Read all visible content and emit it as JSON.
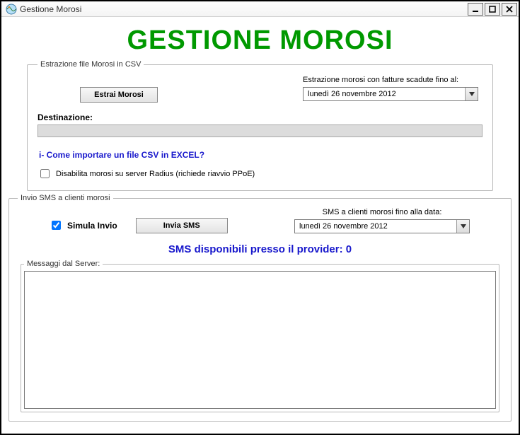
{
  "window": {
    "title": "Gestione Morosi"
  },
  "header": {
    "title": "GESTIONE MOROSI"
  },
  "extract": {
    "legend": "Estrazione file Morosi in CSV",
    "button": "Estrai Morosi",
    "date_label": "Estrazione morosi con fatture scadute fino al:",
    "date_value": "lunedì   26 novembre 2012",
    "dest_label": "Destinazione:",
    "dest_value": "",
    "help_text": "i- Come importare un file CSV in EXCEL?",
    "disable_checkbox_label": "Disabilita morosi su server Radius (richiede riavvio PPoE)",
    "disable_checked": false
  },
  "sms": {
    "legend": "Invio SMS a clienti morosi",
    "simulate_label": "Simula Invio",
    "simulate_checked": true,
    "button": "Invia SMS",
    "date_label": "SMS a clienti morosi fino alla data:",
    "date_value": "lunedì   26 novembre 2012",
    "available_prefix": "SMS disponibili presso il provider: ",
    "available_count": "0"
  },
  "log": {
    "legend": "Messaggi dal Server:"
  }
}
